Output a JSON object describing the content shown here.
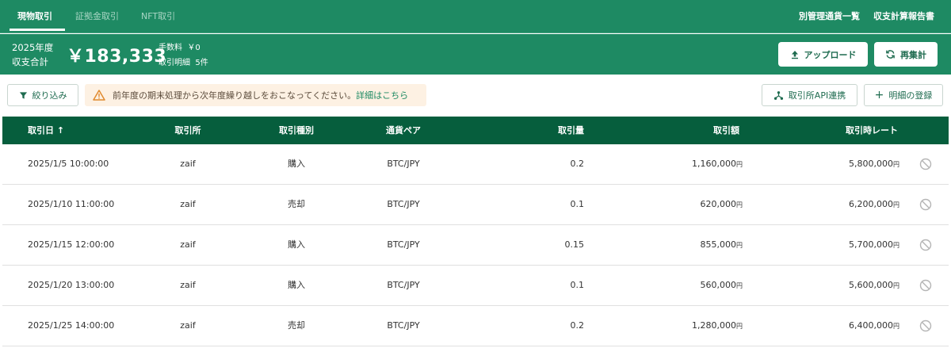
{
  "nav": {
    "tabs": [
      {
        "label": "現物取引",
        "active": true
      },
      {
        "label": "証拠金取引",
        "active": false
      },
      {
        "label": "NFT取引",
        "active": false
      }
    ],
    "links": [
      "別管理通貨一覧",
      "収支計算報告書"
    ]
  },
  "summary": {
    "year_label": "2025年度",
    "total_label": "収支合計",
    "total_value": "￥183,333",
    "fee_label": "手数料",
    "fee_value": "￥0",
    "detail_label": "取引明細",
    "detail_value": "5件",
    "upload_label": "アップロード",
    "recalc_label": "再集計"
  },
  "toolbar": {
    "filter_label": "絞り込み",
    "warning_text": "前年度の期末処理から次年度繰り越しをおこなってください。",
    "warning_link": "詳細はこちら",
    "api_label": "取引所API連携",
    "add_label": "明細の登録"
  },
  "table": {
    "columns": [
      "取引日",
      "取引所",
      "取引種別",
      "通貨ペア",
      "取引量",
      "取引額",
      "取引時レート"
    ],
    "sort_indicator": "↑",
    "currency_unit": "円",
    "rows": [
      {
        "date": "2025/1/5 10:00:00",
        "exchange": "zaif",
        "type": "購入",
        "pair": "BTC/JPY",
        "amount": "0.2",
        "value": "1,160,000",
        "rate": "5,800,000"
      },
      {
        "date": "2025/1/10 11:00:00",
        "exchange": "zaif",
        "type": "売却",
        "pair": "BTC/JPY",
        "amount": "0.1",
        "value": "620,000",
        "rate": "6,200,000"
      },
      {
        "date": "2025/1/15 12:00:00",
        "exchange": "zaif",
        "type": "購入",
        "pair": "BTC/JPY",
        "amount": "0.15",
        "value": "855,000",
        "rate": "5,700,000"
      },
      {
        "date": "2025/1/20 13:00:00",
        "exchange": "zaif",
        "type": "購入",
        "pair": "BTC/JPY",
        "amount": "0.1",
        "value": "560,000",
        "rate": "5,600,000"
      },
      {
        "date": "2025/1/25 14:00:00",
        "exchange": "zaif",
        "type": "売却",
        "pair": "BTC/JPY",
        "amount": "0.2",
        "value": "1,280,000",
        "rate": "6,400,000"
      }
    ]
  },
  "colors": {
    "primary": "#1e8a63",
    "header": "#065e3d",
    "warning_bg": "#fdf1e3",
    "warning_icon": "#e08a2e"
  }
}
